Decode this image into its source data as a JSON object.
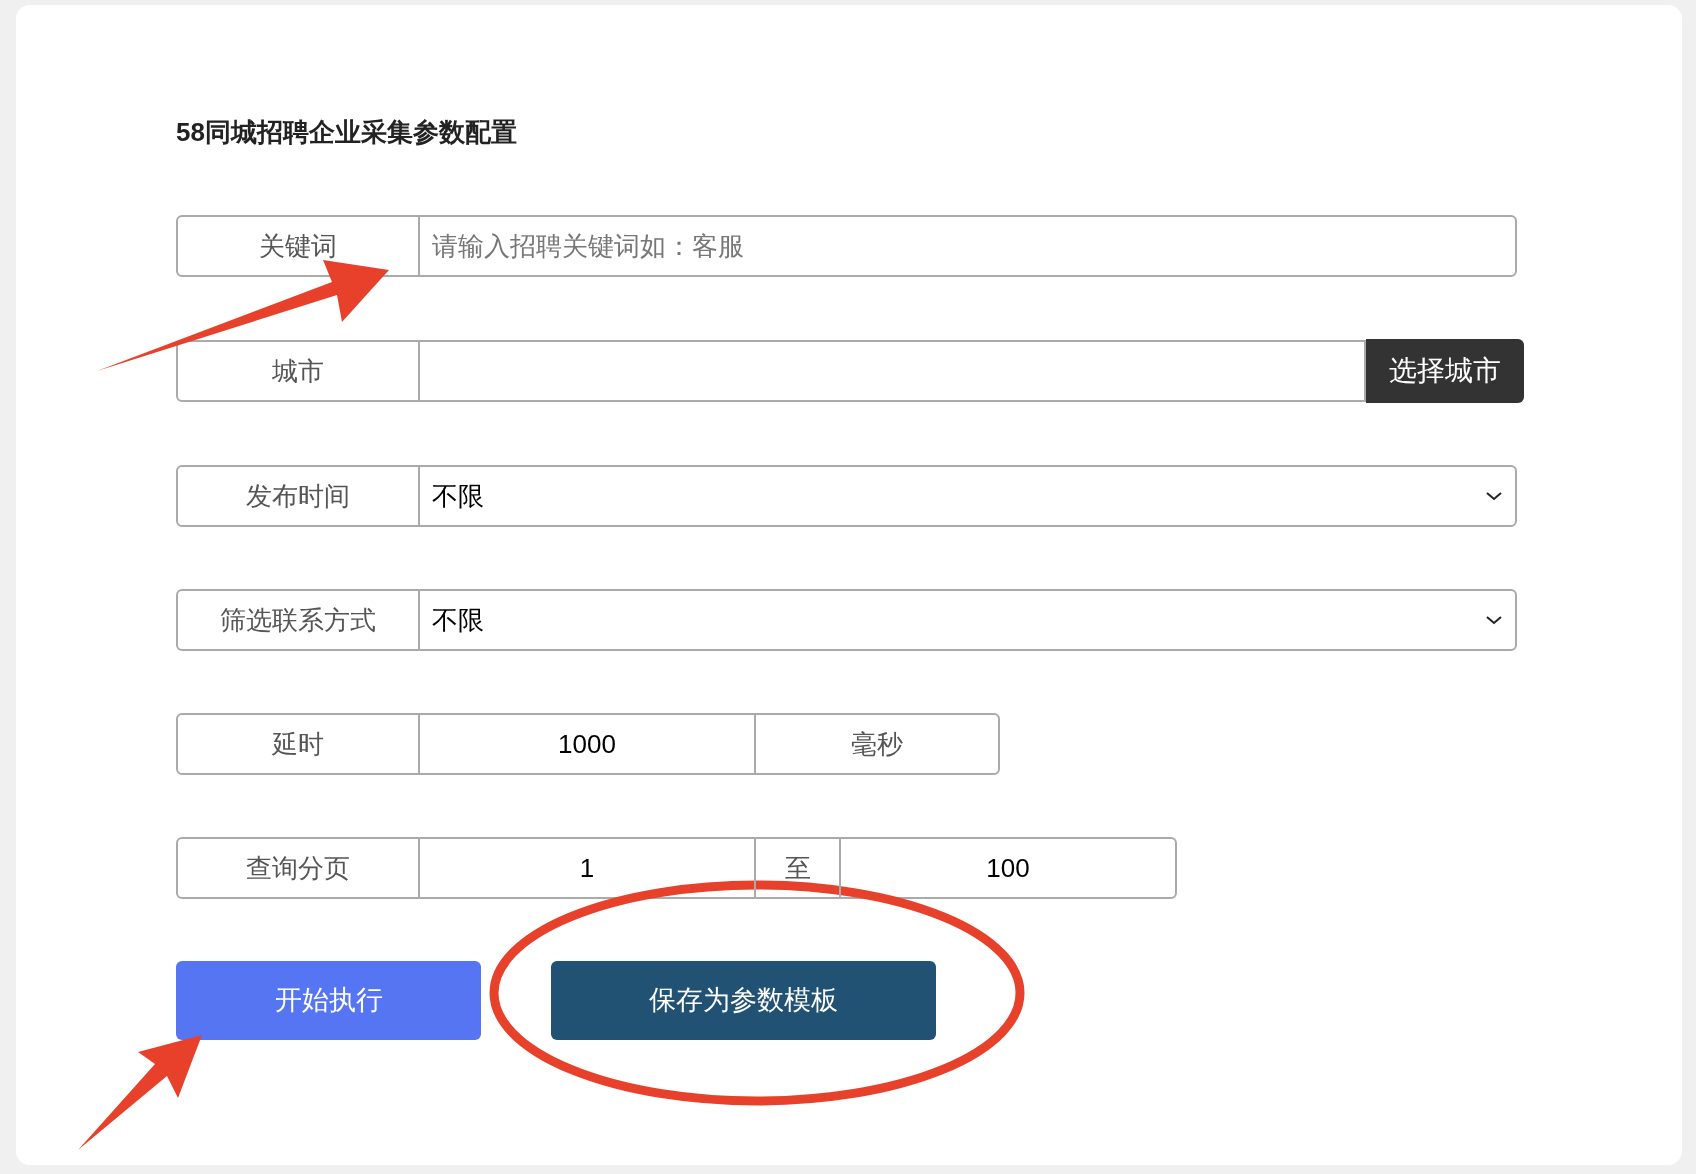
{
  "title": "58同城招聘企业采集参数配置",
  "fields": [
    {
      "kind": "text",
      "label": "关键词",
      "placeholder": "请输入招聘关键词如：客服"
    },
    {
      "kind": "picker",
      "label": "城市",
      "button": "选择城市"
    },
    {
      "kind": "select",
      "label": "发布时间",
      "value": "不限"
    },
    {
      "kind": "select",
      "label": "筛选联系方式",
      "value": "不限"
    },
    {
      "kind": "unit",
      "label": "延时",
      "value": "1000",
      "unit": "毫秒"
    },
    {
      "kind": "range",
      "label": "查询分页",
      "from": "1",
      "separator": "至",
      "to": "100"
    }
  ],
  "buttons": [
    {
      "label": "开始执行",
      "kind": "primary"
    },
    {
      "label": "保存为参数模板",
      "kind": "secondary"
    }
  ]
}
